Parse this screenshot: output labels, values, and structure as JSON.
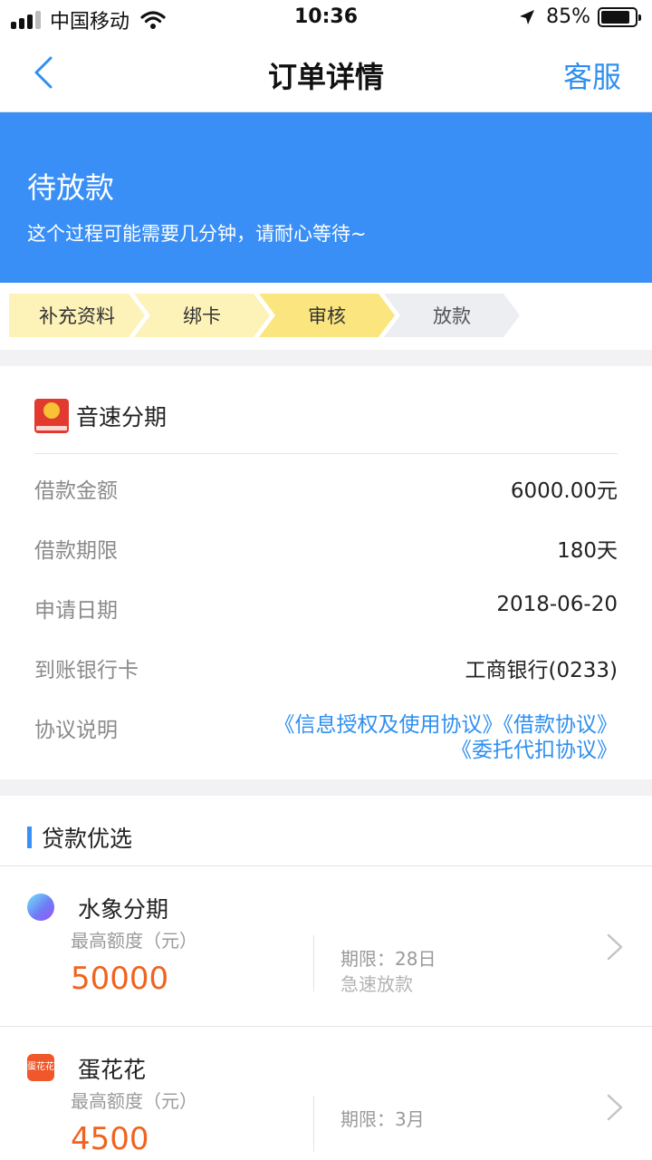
{
  "status_bar": {
    "carrier": "中国移动",
    "time": "10:36",
    "battery": "85%",
    "battery_level": 0.85
  },
  "navbar": {
    "back_icon": "chevron-left-icon",
    "title": "订单详情",
    "service_label": "客服"
  },
  "banner": {
    "status": "待放款",
    "description": "这个过程可能需要几分钟，请耐心等待~"
  },
  "steps": [
    {
      "label": "补充资料",
      "state": "done"
    },
    {
      "label": "绑卡",
      "state": "done"
    },
    {
      "label": "审核",
      "state": "current"
    },
    {
      "label": "放款",
      "state": "todo"
    }
  ],
  "order": {
    "brand_name": "音速分期",
    "brand_logo_text": "音速分期",
    "rows": [
      {
        "label": "借款金额",
        "value": "6000.00元"
      },
      {
        "label": "借款期限",
        "value": "180天"
      },
      {
        "label": "申请日期",
        "value": "2018-06-20"
      },
      {
        "label": "到账银行卡",
        "value": "工商银行(0233)"
      }
    ],
    "agreement_label": "协议说明",
    "agreements": [
      "《信息授权及使用协议》",
      "《借款协议》",
      "《委托代扣协议》"
    ]
  },
  "recommend": {
    "title": "贷款优选",
    "items": [
      {
        "name": "水象分期",
        "max_label": "最高额度（元）",
        "amount": "50000",
        "term": "期限：28日",
        "note": "急速放款",
        "logo": "water-logo-icon"
      },
      {
        "name": "蛋花花",
        "max_label": "最高额度（元）",
        "amount": "4500",
        "term": "期限：3月",
        "note": "",
        "logo": "egg-logo-icon",
        "logo_text": "蛋花花"
      }
    ]
  },
  "colors": {
    "accent": "#3a8ff6",
    "link": "#2f8ff0",
    "amount": "#f0631f",
    "step_done": "#fdf2b8",
    "step_current": "#fbe57e",
    "step_todo": "#eceef2"
  }
}
